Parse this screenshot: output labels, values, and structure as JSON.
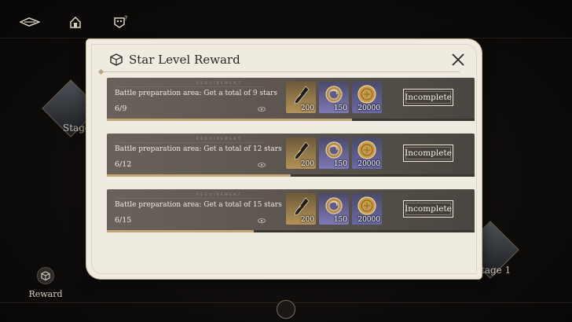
{
  "hud": {
    "icons": [
      "back-arrow-icon",
      "home-icon",
      "help-mask-icon"
    ],
    "stage_left_label": "Stage",
    "stage_right_label": "tage 1",
    "reward_label": "Reward"
  },
  "dialog": {
    "title": "Star Level Reward",
    "close_icon": "close-icon",
    "rows": [
      {
        "requirement_tag": "REQUIREMENT",
        "description": "Battle preparation area: Get a total of 9 stars",
        "progress": "6/9",
        "progress_fraction": 0.667,
        "rewards": [
          {
            "icon": "quill-ink-icon",
            "amount": "200"
          },
          {
            "icon": "compass-medal-icon",
            "amount": "150"
          },
          {
            "icon": "gold-coin-icon",
            "amount": "20000"
          }
        ],
        "status": "Incomplete"
      },
      {
        "requirement_tag": "REQUIREMENT",
        "description": "Battle preparation area: Get a total of 12 stars",
        "progress": "6/12",
        "progress_fraction": 0.5,
        "rewards": [
          {
            "icon": "quill-ink-icon",
            "amount": "200"
          },
          {
            "icon": "compass-medal-icon",
            "amount": "150"
          },
          {
            "icon": "gold-coin-icon",
            "amount": "20000"
          }
        ],
        "status": "Incomplete"
      },
      {
        "requirement_tag": "REQUIREMENT",
        "description": "Battle preparation area: Get a total of 15 stars",
        "progress": "6/15",
        "progress_fraction": 0.4,
        "rewards": [
          {
            "icon": "quill-ink-icon",
            "amount": "200"
          },
          {
            "icon": "compass-medal-icon",
            "amount": "150"
          },
          {
            "icon": "gold-coin-icon",
            "amount": "20000"
          }
        ],
        "status": "Incomplete"
      }
    ]
  },
  "colors": {
    "dialog_bg": "#f0ebe1",
    "row_bg": "#5c554f",
    "progress_fill": "#c4a778",
    "gold_slot": "#b59257",
    "purple_slot": "#7f79b6"
  }
}
